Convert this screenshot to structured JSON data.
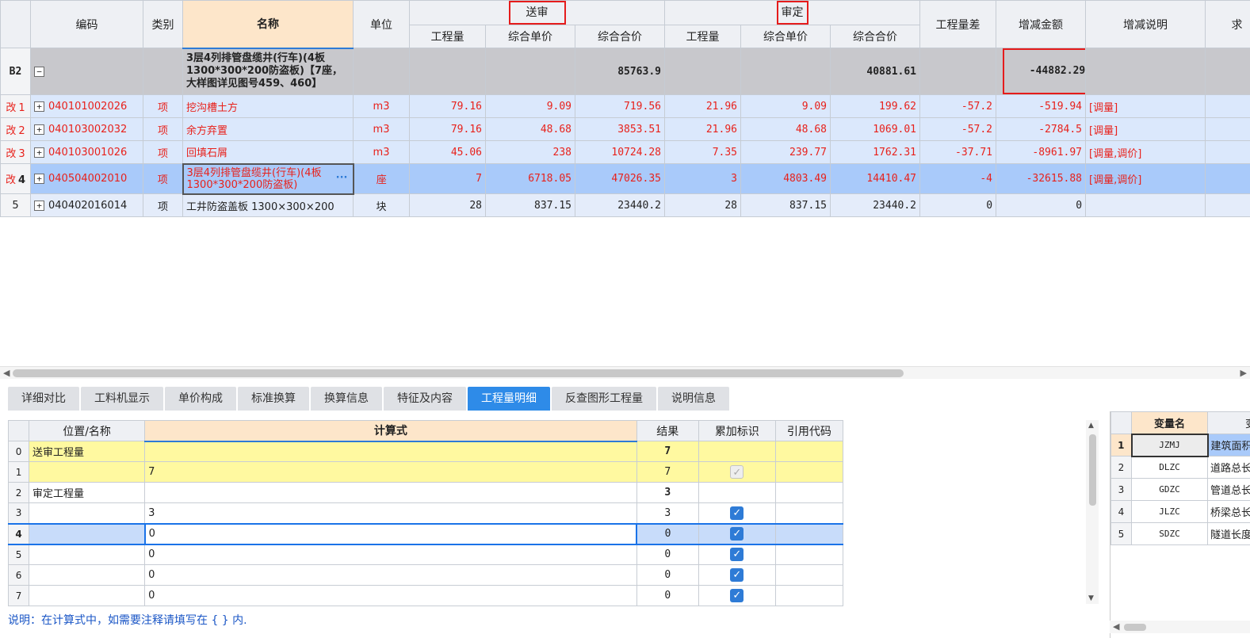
{
  "main_grid": {
    "headers": {
      "code": "编码",
      "type": "类别",
      "name": "名称",
      "unit": "单位",
      "submitted_group": "送审",
      "approved_group": "审定",
      "qty": "工程量",
      "unit_price": "综合单价",
      "total_price": "综合合价",
      "qty_diff": "工程量差",
      "change_amount": "增减金额",
      "change_note": "增减说明",
      "extra": "求"
    },
    "group_row": {
      "id": "B2",
      "expander": "−",
      "name": "3层4列排管盘缆井(行车)(4板1300*300*200防盗板)【7座，大样图详见图号459、460】",
      "submitted_total": "85763.9",
      "approved_total": "40881.61",
      "change_amount": "-44882.29"
    },
    "rows": [
      {
        "flag": "改",
        "num": "1",
        "code": "040101002026",
        "type": "项",
        "name": "挖沟槽土方",
        "unit": "m3",
        "s_qty": "79.16",
        "s_price": "9.09",
        "s_total": "719.56",
        "a_qty": "21.96",
        "a_price": "9.09",
        "a_total": "199.62",
        "qty_diff": "-57.2",
        "change": "-519.94",
        "note": "[调量]"
      },
      {
        "flag": "改",
        "num": "2",
        "code": "040103002032",
        "type": "项",
        "name": "余方弃置",
        "unit": "m3",
        "s_qty": "79.16",
        "s_price": "48.68",
        "s_total": "3853.51",
        "a_qty": "21.96",
        "a_price": "48.68",
        "a_total": "1069.01",
        "qty_diff": "-57.2",
        "change": "-2784.5",
        "note": "[调量]"
      },
      {
        "flag": "改",
        "num": "3",
        "code": "040103001026",
        "type": "项",
        "name": "回填石屑",
        "unit": "m3",
        "s_qty": "45.06",
        "s_price": "238",
        "s_total": "10724.28",
        "a_qty": "7.35",
        "a_price": "239.77",
        "a_total": "1762.31",
        "qty_diff": "-37.71",
        "change": "-8961.97",
        "note": "[调量,调价]"
      },
      {
        "flag": "改",
        "num": "4",
        "code": "040504002010",
        "type": "项",
        "name": "3层4列排管盘缆井(行车)(4板1300*300*200防盗板)",
        "unit": "座",
        "s_qty": "7",
        "s_price": "6718.05",
        "s_total": "47026.35",
        "a_qty": "3",
        "a_price": "4803.49",
        "a_total": "14410.47",
        "qty_diff": "-4",
        "change": "-32615.88",
        "note": "[调量,调价]"
      },
      {
        "flag": "",
        "num": "5",
        "code": "040402016014",
        "type": "项",
        "name": "工井防盗盖板 1300×300×200",
        "unit": "块",
        "s_qty": "28",
        "s_price": "837.15",
        "s_total": "23440.2",
        "a_qty": "28",
        "a_price": "837.15",
        "a_total": "23440.2",
        "qty_diff": "0",
        "change": "0",
        "note": ""
      }
    ],
    "ellipsis": "···",
    "expander_plus": "+"
  },
  "tabs": [
    "详细对比",
    "工料机显示",
    "单价构成",
    "标准换算",
    "换算信息",
    "特征及内容",
    "工程量明细",
    "反查图形工程量",
    "说明信息"
  ],
  "active_tab": "工程量明细",
  "detail_grid": {
    "headers": {
      "position": "位置/名称",
      "formula": "计算式",
      "result": "结果",
      "accumulate": "累加标识",
      "ref_code": "引用代码"
    },
    "rows": [
      {
        "num": "0",
        "position": "送审工程量",
        "formula": "",
        "result": "7"
      },
      {
        "num": "1",
        "position": "",
        "formula": "7",
        "result": "7"
      },
      {
        "num": "2",
        "position": "审定工程量",
        "formula": "",
        "result": "3"
      },
      {
        "num": "3",
        "position": "",
        "formula": "3",
        "result": "3"
      },
      {
        "num": "4",
        "position": "",
        "formula": "0",
        "result": "0"
      },
      {
        "num": "5",
        "position": "",
        "formula": "0",
        "result": "0"
      },
      {
        "num": "6",
        "position": "",
        "formula": "0",
        "result": "0"
      },
      {
        "num": "7",
        "position": "",
        "formula": "0",
        "result": "0"
      }
    ],
    "check_mark": "✓"
  },
  "note": "说明：在计算式中，如需要注释请填写在 { } 内.",
  "var_panel": {
    "headers": {
      "name": "变量名",
      "desc": "变"
    },
    "rows": [
      {
        "num": "1",
        "code": "JZMJ",
        "desc": "建筑面积"
      },
      {
        "num": "2",
        "code": "DLZC",
        "desc": "道路总长"
      },
      {
        "num": "3",
        "code": "GDZC",
        "desc": "管道总长"
      },
      {
        "num": "4",
        "code": "JLZC",
        "desc": "桥梁总长"
      },
      {
        "num": "5",
        "code": "SDZC",
        "desc": "隧道长度"
      }
    ]
  },
  "scroll_arrows": {
    "left": "◀",
    "right": "▶",
    "up": "▲",
    "down": "▼"
  },
  "colors": {
    "accent": "#2e8be8",
    "changed_text": "#e8211b",
    "highlight_box": "#e51c1c",
    "header_name_bg": "#fde6ca",
    "row_selected": "#a9cafa"
  }
}
